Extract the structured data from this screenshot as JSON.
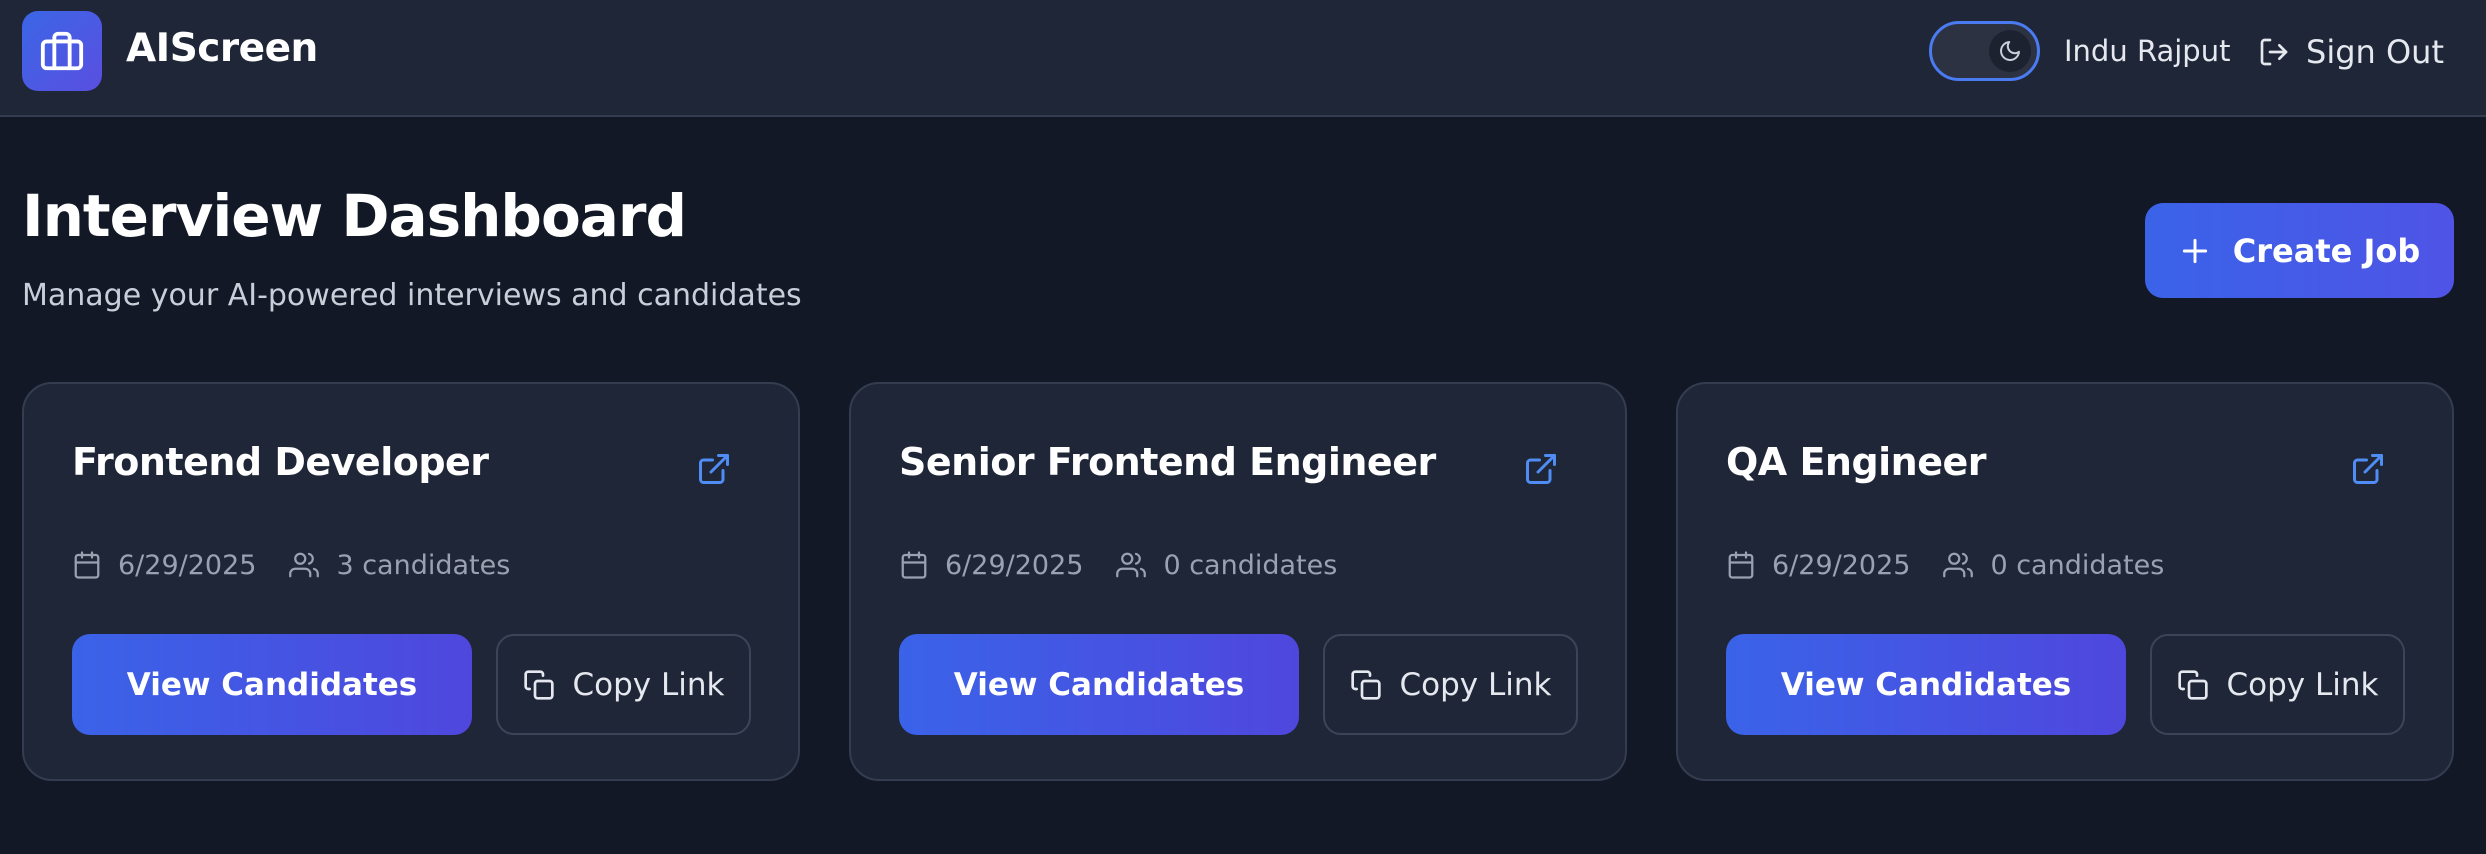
{
  "header": {
    "app_title": "AIScreen",
    "logo_icon": "briefcase-icon",
    "theme_toggle_icon": "moon-icon",
    "user_name": "Indu Rajput",
    "signout_label": "Sign Out",
    "signout_icon": "log-out-icon"
  },
  "page": {
    "title": "Interview Dashboard",
    "subtitle": "Manage your AI-powered interviews and candidates",
    "create_label": "Create Job",
    "create_icon": "plus-icon"
  },
  "jobs": [
    {
      "title": "Frontend Developer",
      "date": "6/29/2025",
      "candidates": "3 candidates",
      "view_label": "View Candidates",
      "copy_label": "Copy Link"
    },
    {
      "title": "Senior Frontend Engineer",
      "date": "6/29/2025",
      "candidates": "0 candidates",
      "view_label": "View Candidates",
      "copy_label": "Copy Link"
    },
    {
      "title": "QA Engineer",
      "date": "6/29/2025",
      "candidates": "0 candidates",
      "view_label": "View Candidates",
      "copy_label": "Copy Link"
    }
  ],
  "colors": {
    "background": "#121826",
    "surface": "#1f2637",
    "accent_start": "#3a63e8",
    "accent_end": "#4f47dd",
    "link_icon": "#4f8df5"
  }
}
